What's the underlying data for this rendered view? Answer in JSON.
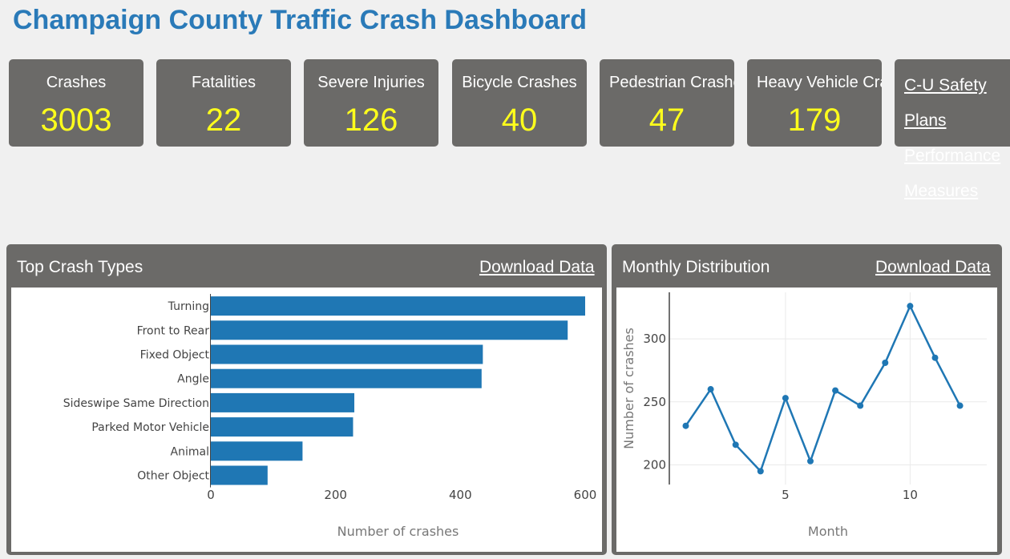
{
  "header": {
    "title": "Champaign County Traffic Crash Dashboard"
  },
  "stats": [
    {
      "label": "Crashes",
      "value": "3003"
    },
    {
      "label": "Fatalities",
      "value": "22"
    },
    {
      "label": "Severe Injuries",
      "value": "126"
    },
    {
      "label": "Bicycle Crashes",
      "value": "40"
    },
    {
      "label": "Pedestrian Crashes",
      "value": "47"
    },
    {
      "label": "Heavy Vehicle Crashes",
      "value": "179"
    }
  ],
  "links": {
    "safety_plans_line1": "C-U Safety",
    "safety_plans_line2": "Plans",
    "performance_line1": "Performance",
    "performance_line2": "Measures"
  },
  "panels": {
    "crash_types": {
      "title": "Top Crash Types",
      "download_label": "Download Data"
    },
    "monthly": {
      "title": "Monthly Distribution",
      "download_label": "Download Data"
    }
  },
  "colors": {
    "bar": "#1f77b4",
    "title": "#2a7ab8",
    "stat_value": "#ffff1c",
    "panel": "#6b6a68"
  },
  "chart_data": [
    {
      "type": "bar",
      "orientation": "horizontal",
      "categories": [
        "Turning",
        "Front to Rear",
        "Fixed Object",
        "Angle",
        "Sideswipe Same Direction",
        "Parked Motor Vehicle",
        "Animal",
        "Other Object"
      ],
      "values": [
        600,
        572,
        436,
        434,
        230,
        228,
        147,
        91
      ],
      "xlabel": "Number of crashes",
      "ylabel": "",
      "xlim": [
        0,
        600
      ],
      "xticks": [
        "0",
        "200",
        "400",
        "600"
      ],
      "grid": false
    },
    {
      "type": "line",
      "x": [
        1,
        2,
        3,
        4,
        5,
        6,
        7,
        8,
        9,
        10,
        11,
        12
      ],
      "y": [
        231,
        260,
        216,
        195,
        253,
        203,
        259,
        247,
        281,
        326,
        285,
        247
      ],
      "xlabel": "Month",
      "ylabel": "Number of crashes",
      "xticks": [
        "5",
        "10"
      ],
      "yticks": [
        "200",
        "250",
        "300"
      ],
      "grid": true
    }
  ]
}
